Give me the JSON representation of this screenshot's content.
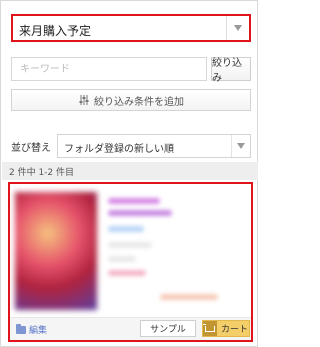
{
  "folder": {
    "selected": "来月購入予定"
  },
  "search": {
    "placeholder": "キーワード",
    "button_label": "絞り込み"
  },
  "filter": {
    "button_label": "絞り込み条件を追加",
    "icon": "tuning-icon"
  },
  "sort": {
    "label": "並び替え",
    "selected": "フォルダ登録の新しい順"
  },
  "results": {
    "count_text": "2 件中 1-2 件目"
  },
  "item": {
    "actions": {
      "edit_label": "編集",
      "sample_label": "サンプル",
      "cart_label": "カート"
    }
  },
  "colors": {
    "highlight_border": "#e0151b",
    "cart_button": "#f4ce68",
    "edit_link": "#5a77c8"
  }
}
